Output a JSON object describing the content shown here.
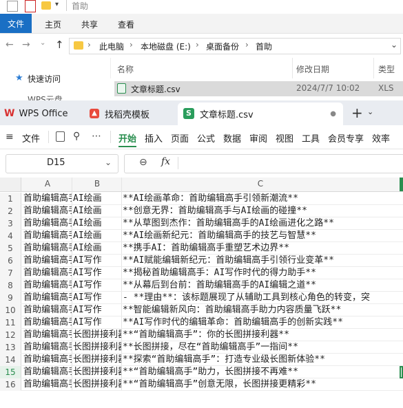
{
  "explorer": {
    "title": "首助",
    "ribbon_tabs": [
      "文件",
      "主页",
      "共享",
      "查看"
    ],
    "breadcrumb": [
      "此电脑",
      "本地磁盘 (E:)",
      "桌面备份",
      "首助"
    ],
    "sidebar": [
      "快速访问",
      "WPS云盘"
    ],
    "columns": [
      "名称",
      "修改日期",
      "类型"
    ],
    "file": {
      "name": "文章标题.csv",
      "date": "2024/7/7 10:02",
      "type": "XLS"
    }
  },
  "wps": {
    "tabs": [
      "WPS Office",
      "找稻壳模板",
      "文章标题.csv"
    ],
    "menu": [
      "文件",
      "开始",
      "插入",
      "页面",
      "公式",
      "数据",
      "审阅",
      "视图",
      "工具",
      "会员专享",
      "效率"
    ],
    "cell_ref": "D15",
    "fx_label": "fx",
    "columns": [
      "A",
      "B",
      "C"
    ],
    "rows": [
      {
        "n": "1",
        "a": "首助编辑高手",
        "b": "AI绘画",
        "c": "**AI绘画革命：首助编辑高手引领新潮流**"
      },
      {
        "n": "2",
        "a": "首助编辑高手",
        "b": "AI绘画",
        "c": "**创意无界：首助编辑高手与AI绘画的碰撞**"
      },
      {
        "n": "3",
        "a": "首助编辑高手",
        "b": "AI绘画",
        "c": "**从草图到杰作：首助编辑高手的AI绘画进化之路**"
      },
      {
        "n": "4",
        "a": "首助编辑高手",
        "b": "AI绘画",
        "c": "**AI绘画新纪元：首助编辑高手的技艺与智慧**"
      },
      {
        "n": "5",
        "a": "首助编辑高手",
        "b": "AI绘画",
        "c": "**携手AI：首助编辑高手重塑艺术边界**"
      },
      {
        "n": "6",
        "a": "首助编辑高手",
        "b": "AI写作",
        "c": "**AI赋能编辑新纪元：首助编辑高手引领行业变革**"
      },
      {
        "n": "7",
        "a": "首助编辑高手",
        "b": "AI写作",
        "c": "**揭秘首助编辑高手：AI写作时代的得力助手**"
      },
      {
        "n": "8",
        "a": "首助编辑高手",
        "b": "AI写作",
        "c": "**从幕后到台前：首助编辑高手的AI编辑之道**"
      },
      {
        "n": "9",
        "a": "首助编辑高手",
        "b": "AI写作",
        "c": "- **理由**：该标题展现了从辅助工具到核心角色的转变，突"
      },
      {
        "n": "10",
        "a": "首助编辑高手",
        "b": "AI写作",
        "c": "**智能编辑新风向：首助编辑高手助力内容质量飞跃**"
      },
      {
        "n": "11",
        "a": "首助编辑高手",
        "b": "AI写作",
        "c": "**AI写作时代的编辑革命：首助编辑高手的创新实践**"
      },
      {
        "n": "12",
        "a": "首助编辑高手",
        "b": "长图拼接利器",
        "c": "**“首助编辑高手”：你的长图拼接利器**"
      },
      {
        "n": "13",
        "a": "首助编辑高手",
        "b": "长图拼接利器",
        "c": "**长图拼接，尽在“首助编辑高手”一指间**"
      },
      {
        "n": "14",
        "a": "首助编辑高手",
        "b": "长图拼接利器",
        "c": "**探索“首助编辑高手”：打造专业级长图新体验**"
      },
      {
        "n": "15",
        "a": "首助编辑高手",
        "b": "长图拼接利器",
        "c": "**“首助编辑高手”助力，长图拼接不再难**"
      },
      {
        "n": "16",
        "a": "首助编辑高手",
        "b": "长图拼接利器",
        "c": "**“首助编辑高手”创意无限，长图拼接更精彩**"
      }
    ]
  },
  "colors": {
    "accent_blue": "#1a6fc4",
    "wps_green": "#2a8e4f"
  }
}
